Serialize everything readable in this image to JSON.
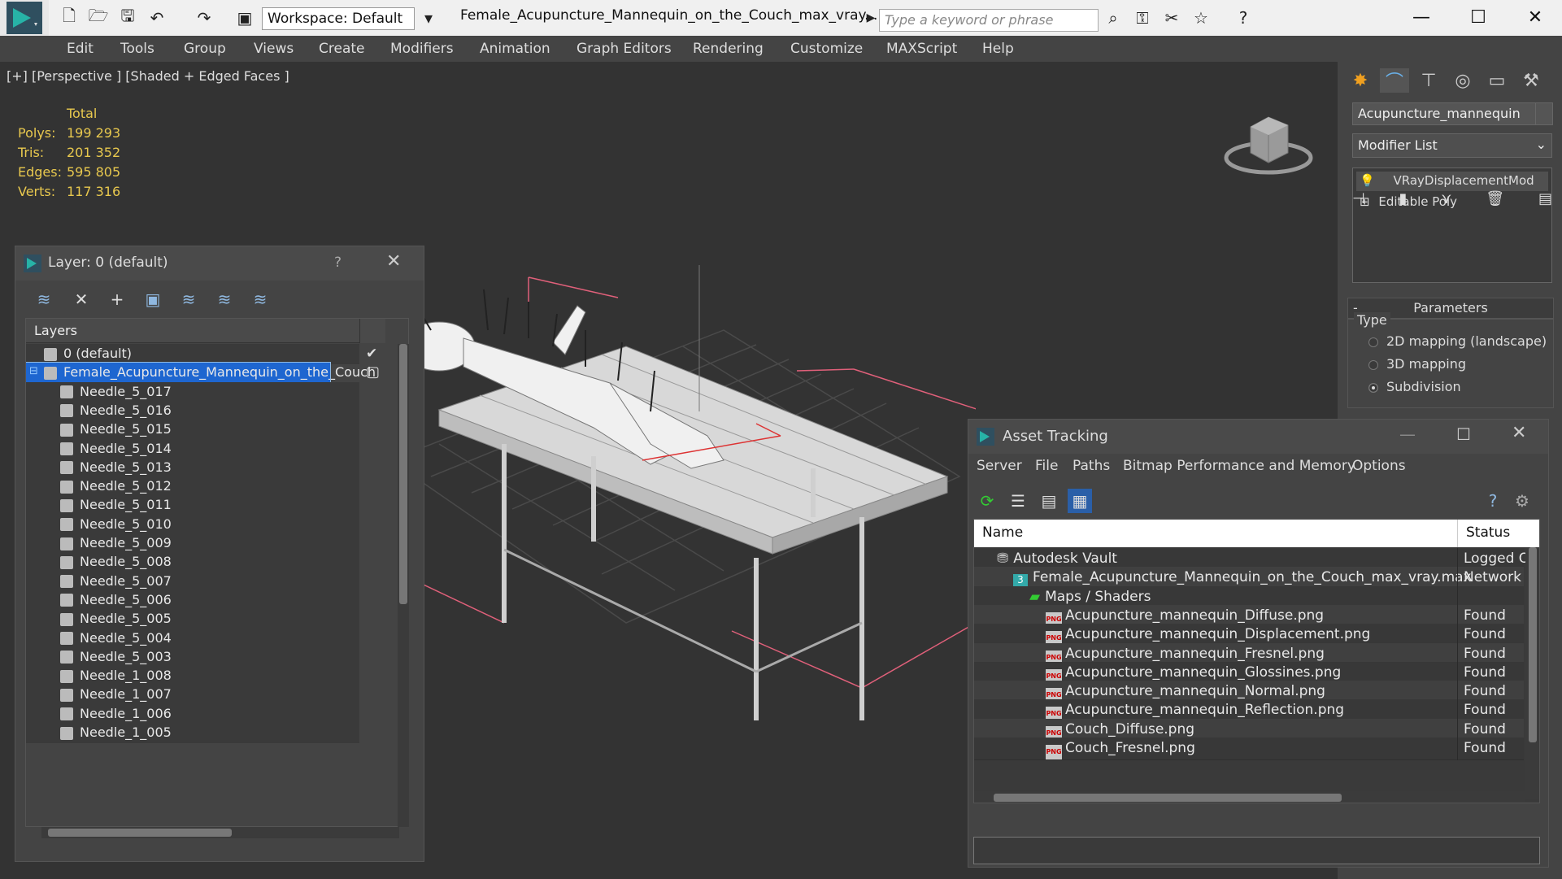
{
  "titlebar": {
    "workspace": "Workspace: Default",
    "doc_title": "Female_Acupuncture_Mannequin_on_the_Couch_max_vray....",
    "search_placeholder": "Type a keyword or phrase"
  },
  "menu": [
    "Edit",
    "Tools",
    "Group",
    "Views",
    "Create",
    "Modifiers",
    "Animation",
    "Graph Editors",
    "Rendering",
    "Customize",
    "MAXScript",
    "Help"
  ],
  "viewport": {
    "label": "[+] [Perspective ] [Shaded + Edged Faces ]",
    "stats": {
      "header": "Total",
      "polys_label": "Polys:",
      "polys": "199 293",
      "tris_label": "Tris:",
      "tris": "201 352",
      "edges_label": "Edges:",
      "edges": "595 805",
      "verts_label": "Verts:",
      "verts": "117 316"
    }
  },
  "command_panel": {
    "object_name": "Acupuncture_mannequin",
    "modifier_list": "Modifier List",
    "stack": [
      "VRayDisplacementMod",
      "Editable Poly"
    ],
    "params_title": "Parameters",
    "type_label": "Type",
    "type_options": [
      "2D mapping (landscape)",
      "3D mapping",
      "Subdivision"
    ],
    "type_selected": "Subdivision"
  },
  "layer_window": {
    "title": "Layer: 0 (default)",
    "help": "?",
    "header": "Layers",
    "rows": [
      "0 (default)",
      "Female_Acupuncture_Mannequin_on_the_Couch",
      "Needle_5_017",
      "Needle_5_016",
      "Needle_5_015",
      "Needle_5_014",
      "Needle_5_013",
      "Needle_5_012",
      "Needle_5_011",
      "Needle_5_010",
      "Needle_5_009",
      "Needle_5_008",
      "Needle_5_007",
      "Needle_5_006",
      "Needle_5_005",
      "Needle_5_004",
      "Needle_5_003",
      "Needle_1_008",
      "Needle_1_007",
      "Needle_1_006",
      "Needle_1_005"
    ]
  },
  "asset_window": {
    "title": "Asset Tracking",
    "menu": [
      "Server",
      "File",
      "Paths",
      "Bitmap Performance and Memory",
      "Options"
    ],
    "col_name": "Name",
    "col_status": "Status",
    "rows": [
      {
        "name": "Autodesk Vault",
        "status": "Logged O"
      },
      {
        "name": "Female_Acupuncture_Mannequin_on_the_Couch_max_vray.max",
        "status": "Network"
      },
      {
        "name": "Maps / Shaders",
        "status": ""
      },
      {
        "name": "Acupuncture_mannequin_Diffuse.png",
        "status": "Found"
      },
      {
        "name": "Acupuncture_mannequin_Displacement.png",
        "status": "Found"
      },
      {
        "name": "Acupuncture_mannequin_Fresnel.png",
        "status": "Found"
      },
      {
        "name": "Acupuncture_mannequin_Glossines.png",
        "status": "Found"
      },
      {
        "name": "Acupuncture_mannequin_Normal.png",
        "status": "Found"
      },
      {
        "name": "Acupuncture_mannequin_Reflection.png",
        "status": "Found"
      },
      {
        "name": "Couch_Diffuse.png",
        "status": "Found"
      },
      {
        "name": "Couch_Fresnel.png",
        "status": "Found"
      }
    ],
    "png_badge": "PNG"
  },
  "colors": {
    "accent": "#1e66d0",
    "stats": "#e8c84e",
    "selection_box": "#e0607a"
  }
}
